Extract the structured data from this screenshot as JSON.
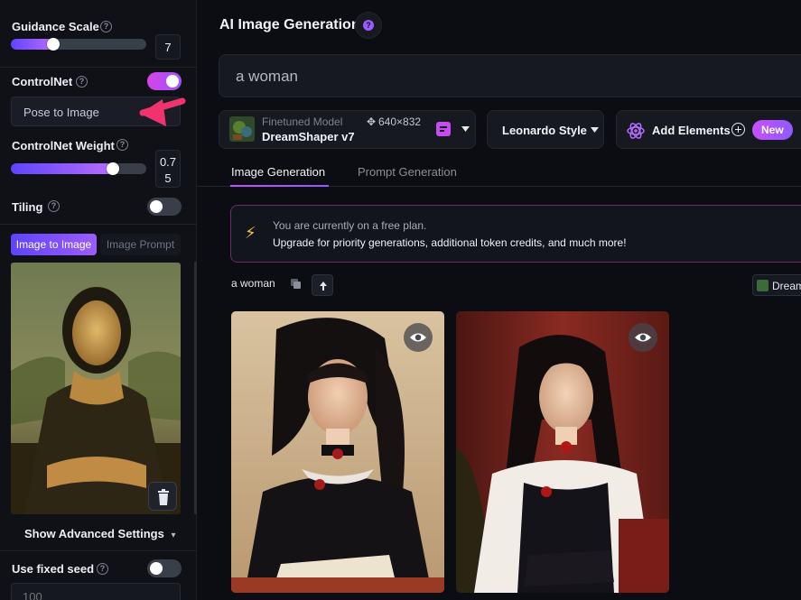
{
  "sidebar": {
    "guidance": {
      "label": "Guidance Scale",
      "help": "?",
      "value": "7",
      "fraction": 0.31
    },
    "controlnet": {
      "label": "ControlNet",
      "help": "?",
      "enabled": true,
      "mode": "Pose to Image"
    },
    "controlnet_weight": {
      "label": "ControlNet Weight",
      "help": "?",
      "value_line1": "0.7",
      "value_line2": "5",
      "fraction": 0.75
    },
    "tiling": {
      "label": "Tiling",
      "help": "?",
      "enabled": false
    },
    "image_tabs": {
      "active": "Image to Image",
      "inactive": "Image Prompt"
    },
    "delete_icon": "trash-icon",
    "advanced": {
      "label": "Show Advanced Settings",
      "caret": "▾"
    },
    "fixed_seed": {
      "label": "Use fixed seed",
      "help": "?",
      "enabled": false,
      "seed_placeholder": "100"
    }
  },
  "main": {
    "header": {
      "title": "AI Image Generation",
      "help": "?"
    },
    "prompt": {
      "value": "a woman"
    },
    "model": {
      "category": "Finetuned Model",
      "name": "DreamShaper v7",
      "size": "640×832",
      "size_icon": "✥"
    },
    "style": {
      "label": "Leonardo Style"
    },
    "elements": {
      "label": "Add Elements",
      "badge": "New"
    },
    "tabs": [
      {
        "label": "Image Generation",
        "active": true
      },
      {
        "label": "Prompt Generation",
        "active": false
      }
    ],
    "banner": {
      "line1": "You are currently on a free plan.",
      "line2": "Upgrade for priority generations, additional token credits, and much more!"
    },
    "generation": {
      "prompt": "a woman",
      "model_chip": "Dream"
    }
  },
  "colors": {
    "accent_gradient_start": "#5f43ff",
    "accent_gradient_end": "#b76cff",
    "toggle_on": "#d943e4",
    "arrow": "#f0336f",
    "banner_border": "#6d2a6f"
  }
}
